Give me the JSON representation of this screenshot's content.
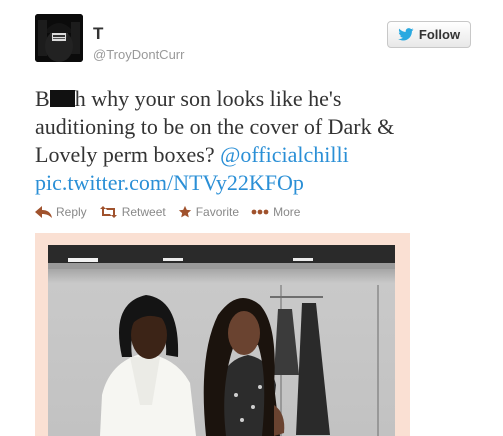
{
  "tweet": {
    "display_name": "T",
    "username": "@TroyDontCurr",
    "text": {
      "line1_start": "B",
      "line1_end": "h why your son looks like he's",
      "line2": "auditioning to be on the cover of Dark &",
      "line3_text": "Lovely perm boxes? ",
      "mention": "@officialchilli",
      "link": "pic.twitter.com/NTVy22KFOp"
    }
  },
  "follow_button": {
    "label": "Follow",
    "icon": "twitter-bird-icon"
  },
  "actions": [
    {
      "label": "Reply",
      "icon": "reply-arrow-icon"
    },
    {
      "label": "Retweet",
      "icon": "retweet-icon"
    },
    {
      "label": "Favorite",
      "icon": "star-icon"
    },
    {
      "label": "More",
      "icon": "dots-icon"
    }
  ],
  "colors": {
    "link": "#2a8fd6",
    "action_icon": "#a0522d",
    "twitter_blue": "#2aa9e0",
    "media_frame": "#fae0d3"
  }
}
